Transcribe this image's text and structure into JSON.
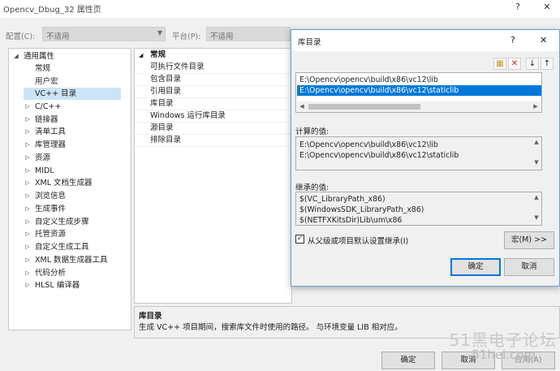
{
  "window": {
    "title": "Opencv_Dbug_32 属性页",
    "help_glyph": "?",
    "close_glyph": "✕"
  },
  "config": {
    "config_label": "配置(C):",
    "config_value": "不适用",
    "platform_label": "平台(P):",
    "platform_value": "不适用"
  },
  "tree": {
    "root": "通用属性",
    "items": [
      {
        "label": "常规"
      },
      {
        "label": "用户宏"
      },
      {
        "label": "VC++ 目录"
      },
      {
        "label": "C/C++"
      },
      {
        "label": "链接器"
      },
      {
        "label": "清单工具"
      },
      {
        "label": "库管理器"
      },
      {
        "label": "资源"
      },
      {
        "label": "MIDL"
      },
      {
        "label": "XML 文档生成器"
      },
      {
        "label": "浏览信息"
      },
      {
        "label": "生成事件"
      },
      {
        "label": "自定义生成步骤"
      },
      {
        "label": "托管资源"
      },
      {
        "label": "自定义生成工具"
      },
      {
        "label": "XML 数据生成器工具"
      },
      {
        "label": "代码分析"
      },
      {
        "label": "HLSL 编译器"
      }
    ]
  },
  "grid": {
    "category": "常规",
    "rows": [
      {
        "label": "可执行文件目录"
      },
      {
        "label": "包含目录"
      },
      {
        "label": "引用目录"
      },
      {
        "label": "库目录"
      },
      {
        "label": "Windows 运行库目录"
      },
      {
        "label": "源目录"
      },
      {
        "label": "排除目录"
      }
    ]
  },
  "description": {
    "title": "库目录",
    "text": "生成 VC++ 项目期间，搜索库文件时使用的路径。 与环境变量 LIB 相对应。"
  },
  "buttons": {
    "ok": "确定",
    "cancel": "取消",
    "apply": "应用(A)"
  },
  "dialog": {
    "title": "库目录",
    "help_glyph": "?",
    "close_glyph": "✕",
    "toolbar_icons": [
      "new-folder-icon",
      "delete-icon",
      "move-down-icon",
      "move-up-icon"
    ],
    "entries": [
      {
        "text": "E:\\Opencv\\opencv\\build\\x86\\vc12\\lib"
      },
      {
        "text": "E:\\Opencv\\opencv\\build\\x86\\vc12\\staticlib"
      }
    ],
    "evaluated_label": "计算的值:",
    "evaluated": [
      {
        "text": "E:\\Opencv\\opencv\\build\\x86\\vc12\\lib"
      },
      {
        "text": "E:\\Opencv\\opencv\\build\\x86\\vc12\\staticlib"
      }
    ],
    "inherited_label": "继承的值:",
    "inherited": [
      {
        "text": "$(VC_LibraryPath_x86)"
      },
      {
        "text": "$(WindowsSDK_LibraryPath_x86)"
      },
      {
        "text": "$(NETFXKitsDir)Lib\\um\\x86"
      }
    ],
    "inherit_checkbox_label": "从父级或项目默认设置继承(I)",
    "inherit_checked": true,
    "macros_button": "宏(M) >>",
    "ok": "确定",
    "cancel": "取消"
  },
  "watermark": {
    "text": "51黑电子论坛",
    "subtext": "51hei.com"
  }
}
